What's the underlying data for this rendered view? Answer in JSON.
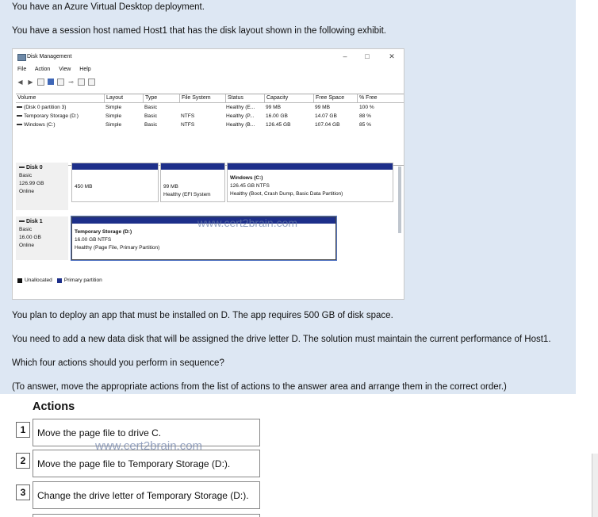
{
  "question": {
    "line1": "You have an Azure Virtual Desktop deployment.",
    "line2": "You have a session host named Host1 that has the disk layout shown in the following exhibit.",
    "line3": "You plan to deploy an app that must be installed on D. The app requires 500 GB of disk space.",
    "line4": "You need to add a new data disk that will be assigned the drive letter D. The solution must maintain the current performance of Host1.",
    "line5": "Which four actions should you perform in sequence?",
    "line6": "(To answer, move the appropriate actions from the list of actions to the answer area and arrange them in the correct order.)"
  },
  "window": {
    "title": "Disk Management",
    "min": "–",
    "max": "□",
    "close": "✕",
    "menu": [
      "File",
      "Action",
      "View",
      "Help"
    ]
  },
  "table": {
    "headers": [
      "Volume",
      "Layout",
      "Type",
      "File System",
      "Status",
      "Capacity",
      "Free Space",
      "% Free"
    ],
    "rows": [
      [
        "(Disk 0 partition 3)",
        "Simple",
        "Basic",
        "",
        "Healthy (E...",
        "99 MB",
        "99 MB",
        "100 %"
      ],
      [
        "Temporary Storage (D:)",
        "Simple",
        "Basic",
        "NTFS",
        "Healthy (P...",
        "16.00 GB",
        "14.07 GB",
        "88 %"
      ],
      [
        "Windows (C:)",
        "Simple",
        "Basic",
        "NTFS",
        "Healthy (B...",
        "126.45 GB",
        "107.04 GB",
        "85 %"
      ]
    ]
  },
  "disks": {
    "disk0": {
      "name": "Disk 0",
      "type": "Basic",
      "size": "126.99 GB",
      "state": "Online"
    },
    "disk1": {
      "name": "Disk 1",
      "type": "Basic",
      "size": "16.00 GB",
      "state": "Online"
    },
    "d0p1": {
      "line1": "450 MB"
    },
    "d0p2": {
      "line1": "99 MB",
      "line2": "Healthy (EFI System"
    },
    "d0p3": {
      "name": "Windows  (C:)",
      "line1": "126.45 GB NTFS",
      "line2": "Healthy (Boot, Crash Dump, Basic Data Partition)"
    },
    "d1p1": {
      "name": "Temporary Storage  (D:)",
      "line1": "16.00 GB NTFS",
      "line2": "Healthy (Page File, Primary Partition)"
    }
  },
  "legend": {
    "unallocated": "Unallocated",
    "primary": "Primary partition",
    "unallocated_color": "#111111",
    "primary_color": "#1d2f8a"
  },
  "watermark": "www.cert2brain.com",
  "actions": {
    "title": "Actions",
    "items": [
      {
        "num": "1",
        "label": "Move the page file to drive C."
      },
      {
        "num": "2",
        "label": "Move the page file to Temporary Storage (D:)."
      },
      {
        "num": "3",
        "label": "Change the drive letter of Temporary Storage (D:)."
      }
    ]
  }
}
